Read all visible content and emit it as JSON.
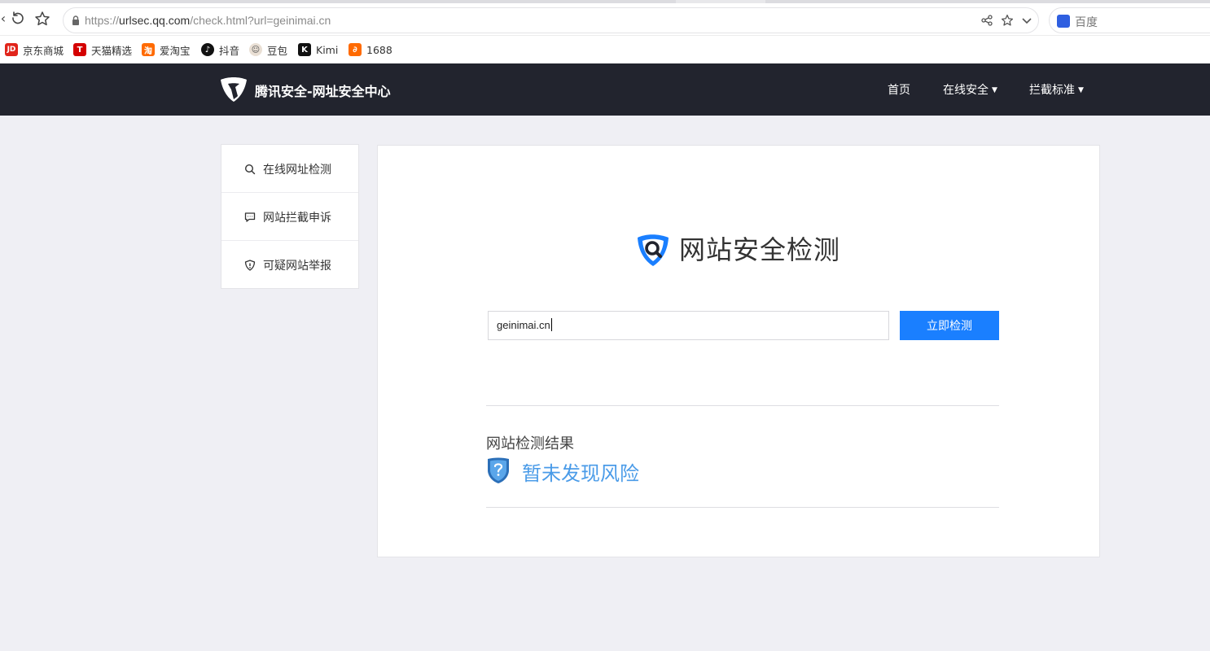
{
  "browser": {
    "url_prefix": "https://",
    "url_host": "urlsec.qq.com",
    "url_path": "/check.html?url=geinimai.cn",
    "search_placeholder": "百度"
  },
  "bookmarks": [
    {
      "label": "京东商城",
      "icon": "jd-icon",
      "color": "#e1251b",
      "glyph": "JD"
    },
    {
      "label": "天猫精选",
      "icon": "tmall-icon",
      "color": "#d40000",
      "glyph": "T"
    },
    {
      "label": "爱淘宝",
      "icon": "taobao-icon",
      "color": "#ff6a00",
      "glyph": "淘"
    },
    {
      "label": "抖音",
      "icon": "douyin-icon",
      "color": "#111111",
      "glyph": "♪"
    },
    {
      "label": "豆包",
      "icon": "doubao-icon",
      "color": "#c9b8a6",
      "glyph": "•"
    },
    {
      "label": "Kimi",
      "icon": "kimi-icon",
      "color": "#111111",
      "glyph": "K"
    },
    {
      "label": "1688",
      "icon": "1688-icon",
      "color": "#ff6a00",
      "glyph": "∂"
    }
  ],
  "header": {
    "logo_text": "腾讯安全-网址安全中心",
    "nav": [
      "首页",
      "在线安全",
      "拦截标准"
    ]
  },
  "sidebar": {
    "items": [
      {
        "label": "在线网址检测",
        "icon": "search-icon"
      },
      {
        "label": "网站拦截申诉",
        "icon": "message-icon"
      },
      {
        "label": "可疑网站举报",
        "icon": "shield-alert-icon"
      }
    ]
  },
  "main": {
    "title": "网站安全检测",
    "input_value": "geinimai.cn",
    "button_label": "立即检测",
    "result_label": "网站检测结果",
    "result_text": "暂未发现风险"
  },
  "colors": {
    "header_bg": "#22242e",
    "primary": "#1a7fff",
    "result_blue": "#4a9be8"
  }
}
